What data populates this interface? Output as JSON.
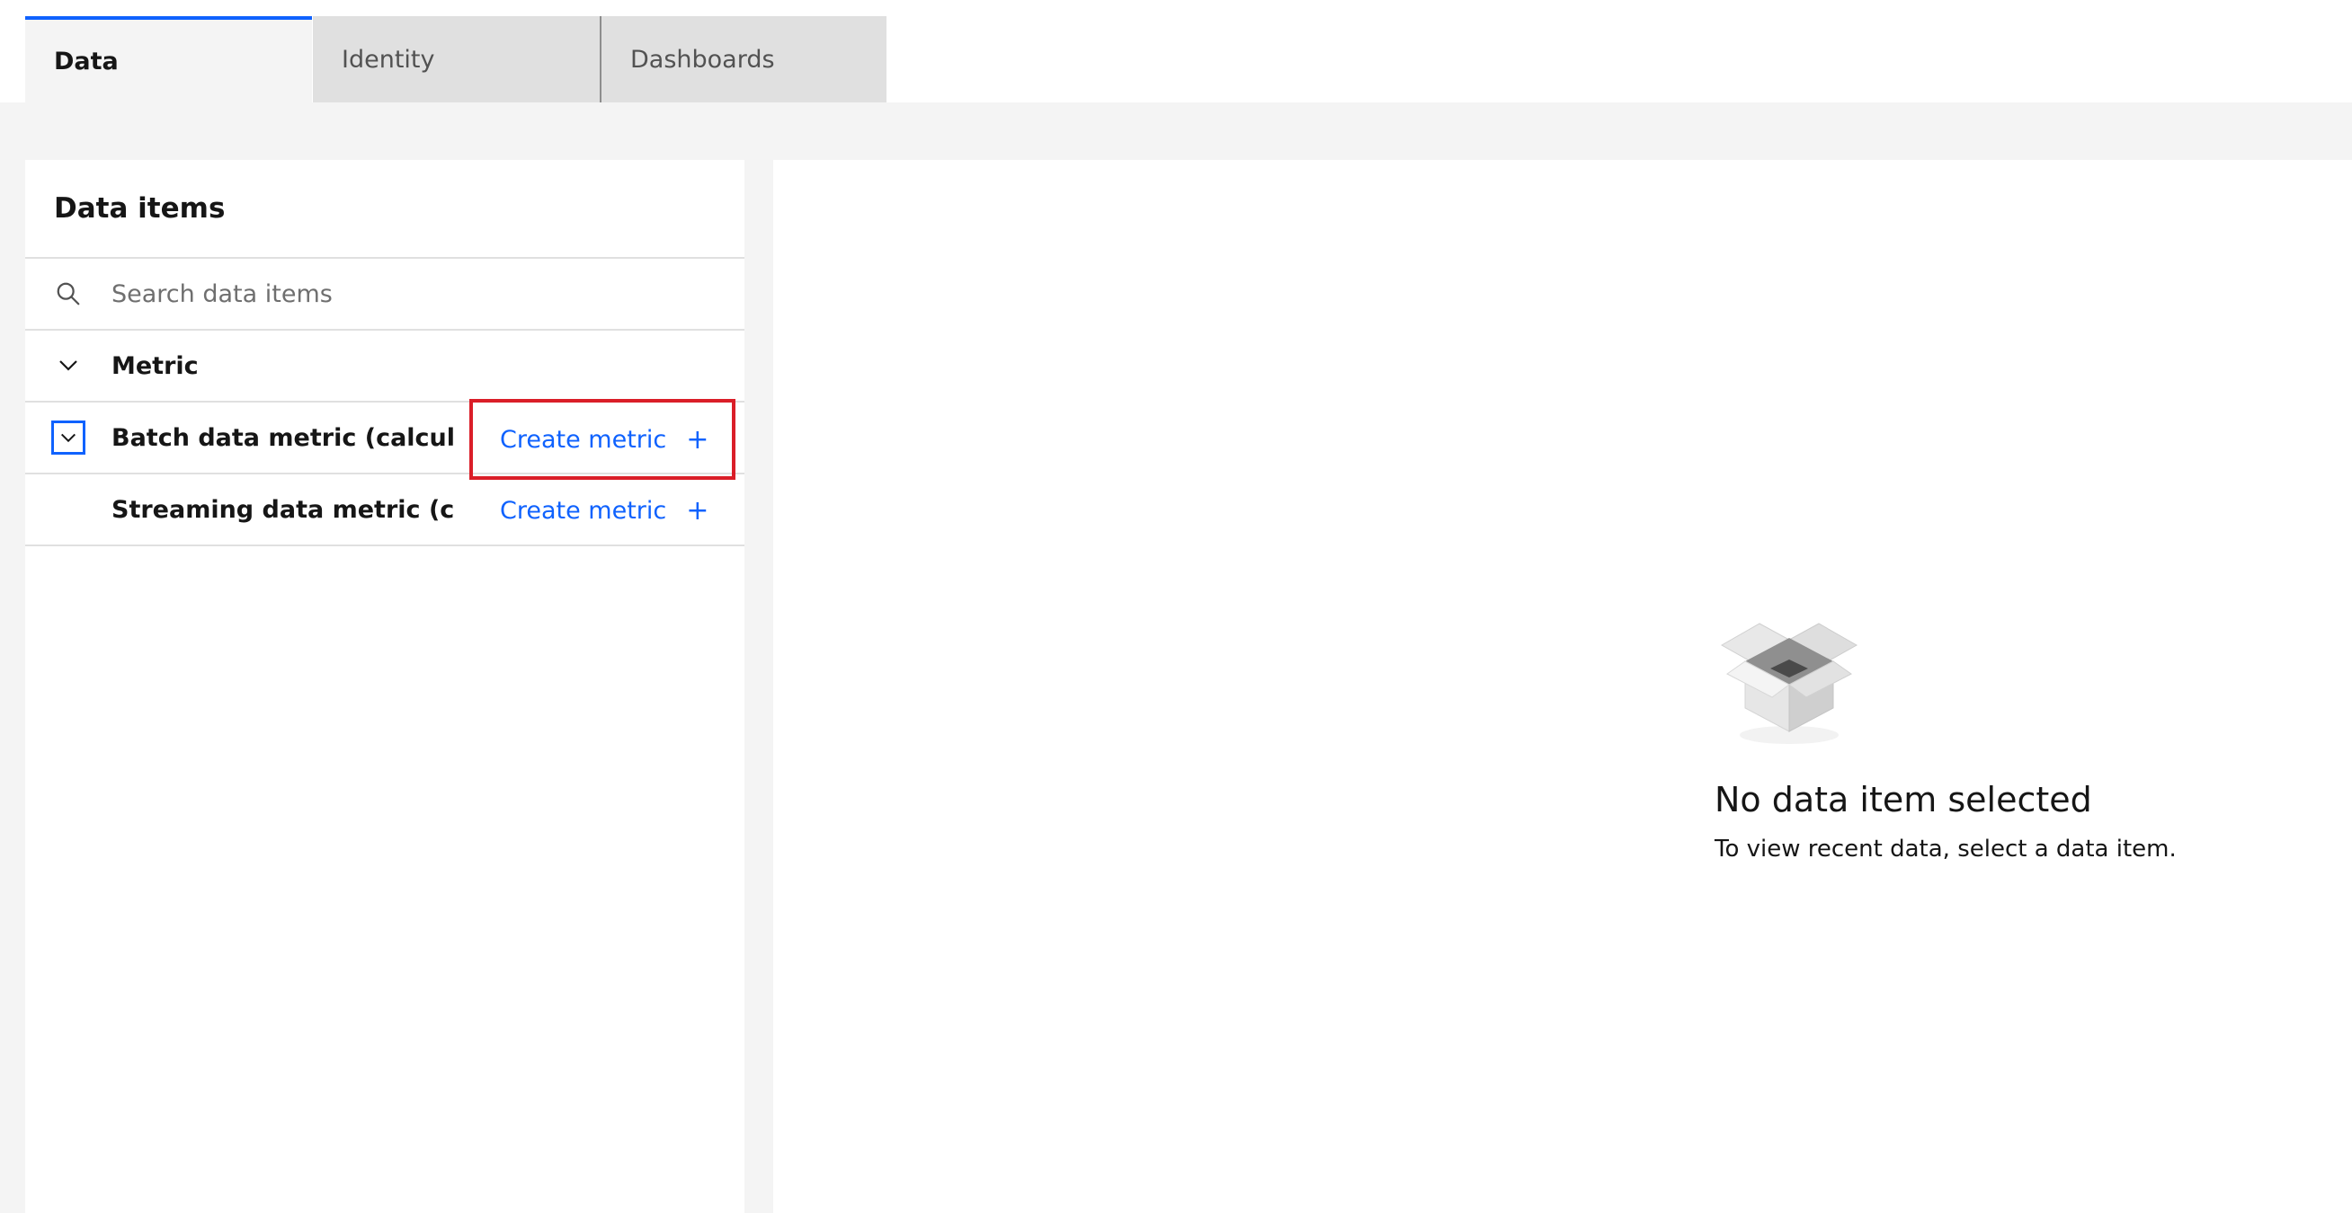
{
  "tabs": [
    {
      "label": "Data",
      "active": true
    },
    {
      "label": "Identity",
      "active": false
    },
    {
      "label": "Dashboards",
      "active": false
    }
  ],
  "left_panel": {
    "title": "Data items",
    "search": {
      "placeholder": "Search data items",
      "value": ""
    },
    "group": {
      "label": "Metric",
      "icon": "chevron-down-icon"
    },
    "items": [
      {
        "label": "Batch data metric (calcula...",
        "action": "Create metric",
        "action_icon": "plus-icon",
        "expand_icon": "chevron-down-icon"
      },
      {
        "label": "Streaming data metric (cal...",
        "action": "Create metric",
        "action_icon": "plus-icon"
      }
    ]
  },
  "empty_state": {
    "icon": "empty-box-icon",
    "title": "No data item selected",
    "subtitle": "To view recent data, select a data item."
  },
  "colors": {
    "accent": "#0f62fe",
    "highlight": "#da1e28",
    "background": "#f4f4f4",
    "tab_inactive": "#e0e0e0"
  }
}
